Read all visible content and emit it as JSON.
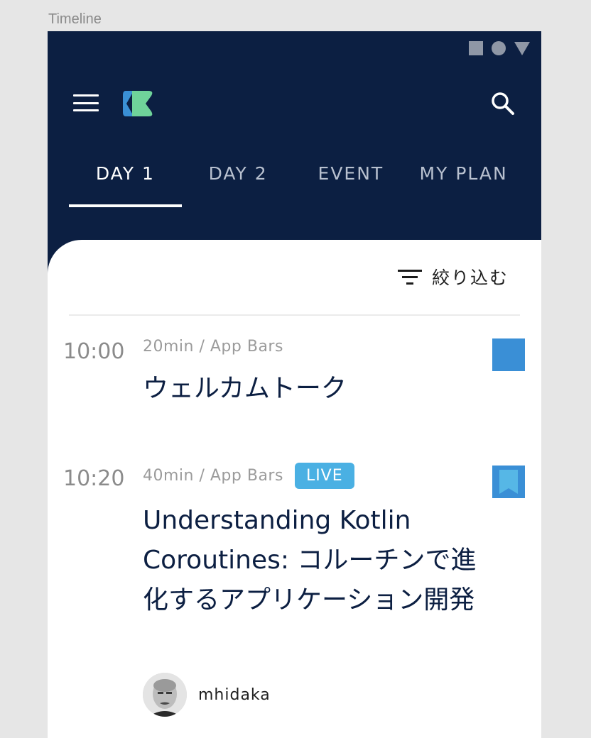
{
  "frame": {
    "label": "Timeline"
  },
  "status_bar": {
    "icons": [
      "square-icon",
      "circle-icon",
      "triangle-icon"
    ]
  },
  "app_bar": {
    "menu_icon": "hamburger-menu-icon",
    "logo_icon": "kotlin-fest-logo-icon",
    "search_icon": "search-icon"
  },
  "tabs": [
    {
      "label": "DAY 1",
      "active": true
    },
    {
      "label": "DAY 2",
      "active": false
    },
    {
      "label": "EVENT",
      "active": false
    },
    {
      "label": "MY PLAN",
      "active": false
    }
  ],
  "filter": {
    "label": "絞り込む",
    "icon": "filter-list-icon"
  },
  "sessions": [
    {
      "time": "10:00",
      "meta": "20min / App Bars",
      "live": false,
      "title": "ウェルカムトーク",
      "bookmarked": false,
      "speaker": null
    },
    {
      "time": "10:20",
      "meta": "40min / App Bars",
      "live": true,
      "live_label": "LIVE",
      "title": "Understanding Kotlin Coroutines: コルーチンで進化するアプリケーション開発",
      "bookmarked": true,
      "speaker": {
        "name": "mhidaka",
        "avatar_icon": "speaker-avatar"
      }
    }
  ],
  "colors": {
    "app_bar_bg": "#0c1f42",
    "accent_blue": "#3a8fd6",
    "live_badge": "#4ab0e3",
    "logo_blue": "#3a8fd6",
    "logo_green": "#6fd39a"
  }
}
